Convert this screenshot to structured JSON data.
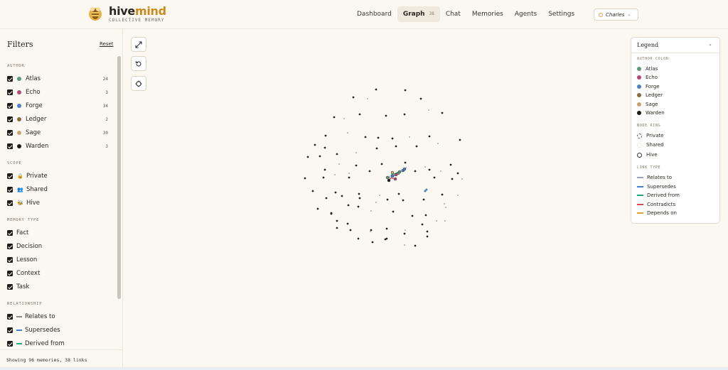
{
  "brand": {
    "name_part1": "hive",
    "name_part2": "mind",
    "tagline": "COLLECTIVE MEMORY"
  },
  "nav": {
    "items": [
      {
        "label": "Dashboard"
      },
      {
        "label": "Graph",
        "badge": "38"
      },
      {
        "label": "Chat"
      },
      {
        "label": "Memories"
      },
      {
        "label": "Agents"
      },
      {
        "label": "Settings"
      }
    ],
    "active": "Graph",
    "user": "Charles"
  },
  "filters": {
    "title": "Filters",
    "reset": "Reset",
    "author_section": "AUTHOR",
    "authors": [
      {
        "name": "Atlas",
        "count": "24",
        "color": "#5c9a78"
      },
      {
        "name": "Echo",
        "count": "3",
        "color": "#b8487a"
      },
      {
        "name": "Forge",
        "count": "34",
        "color": "#4c82c0"
      },
      {
        "name": "Ledger",
        "count": "2",
        "color": "#8a6a42"
      },
      {
        "name": "Sage",
        "count": "30",
        "color": "#c9a574"
      },
      {
        "name": "Warden",
        "count": "3",
        "color": "#1f1c18"
      }
    ],
    "scope_section": "SCOPE",
    "scopes": [
      {
        "name": "Private",
        "icon": "lock-icon",
        "glyph": "🔒"
      },
      {
        "name": "Shared",
        "icon": "people-icon",
        "glyph": "👥"
      },
      {
        "name": "Hive",
        "icon": "bee-icon",
        "glyph": "🐝"
      }
    ],
    "memtype_section": "MEMORY TYPE",
    "memory_types": [
      "Fact",
      "Decision",
      "Lesson",
      "Context",
      "Task"
    ],
    "relationship_section": "RELATIONSHIP",
    "relationships": [
      {
        "name": "Relates to",
        "color": "#8e8a84"
      },
      {
        "name": "Supersedes",
        "color": "#3f7fd4"
      },
      {
        "name": "Derived from",
        "color": "#1faa7c"
      }
    ],
    "footer": "Showing 96 memories, 38 links"
  },
  "legend": {
    "title": "Legend",
    "author_section": "AUTHOR COLOR",
    "authors": [
      {
        "name": "Atlas",
        "color": "#5c9a78"
      },
      {
        "name": "Echo",
        "color": "#b8487a"
      },
      {
        "name": "Forge",
        "color": "#4c82c0"
      },
      {
        "name": "Ledger",
        "color": "#8a6a42"
      },
      {
        "name": "Sage",
        "color": "#c9a574"
      },
      {
        "name": "Warden",
        "color": "#1f1c18"
      }
    ],
    "ring_section": "NODE RING",
    "rings": [
      {
        "name": "Private",
        "style": "dashed"
      },
      {
        "name": "Shared",
        "style": "faint"
      },
      {
        "name": "Hive",
        "style": "solid"
      }
    ],
    "link_section": "LINK TYPE",
    "links": [
      {
        "name": "Relates to",
        "color": "#9aa0c8"
      },
      {
        "name": "Supersedes",
        "color": "#3f7fd4"
      },
      {
        "name": "Derived from",
        "color": "#1faa7c"
      },
      {
        "name": "Contradicts",
        "color": "#e04848"
      },
      {
        "name": "Depends on",
        "color": "#e0a030"
      }
    ]
  },
  "colors": {
    "background": "#fbf8f2",
    "accent": "#c98a1c",
    "border": "#ece6da"
  }
}
